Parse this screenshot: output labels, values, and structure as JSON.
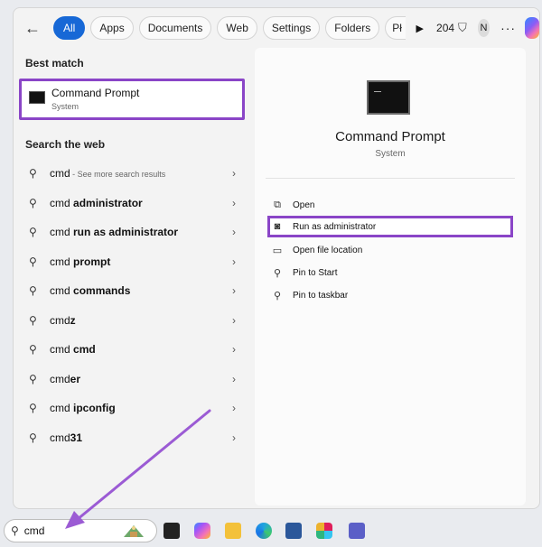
{
  "topbar": {
    "tabs": [
      "All",
      "Apps",
      "Documents",
      "Web",
      "Settings",
      "Folders",
      "Pł"
    ],
    "count": "204",
    "avatar_initial": "N"
  },
  "left": {
    "best_match_label": "Best match",
    "best_match": {
      "title": "Command Prompt",
      "subtitle": "System"
    },
    "search_web_label": "Search the web",
    "web_results": [
      {
        "prefix": "cmd",
        "suffix": "",
        "hint": " - See more search results"
      },
      {
        "prefix": "cmd ",
        "suffix": "administrator",
        "hint": ""
      },
      {
        "prefix": "cmd ",
        "suffix": "run as administrator",
        "hint": ""
      },
      {
        "prefix": "cmd ",
        "suffix": "prompt",
        "hint": ""
      },
      {
        "prefix": "cmd ",
        "suffix": "commands",
        "hint": ""
      },
      {
        "prefix": "cmd",
        "suffix": "z",
        "hint": ""
      },
      {
        "prefix": "cmd ",
        "suffix": "cmd",
        "hint": ""
      },
      {
        "prefix": "cmd",
        "suffix": "er",
        "hint": ""
      },
      {
        "prefix": "cmd ",
        "suffix": "ipconfig",
        "hint": ""
      },
      {
        "prefix": "cmd",
        "suffix": "31",
        "hint": ""
      }
    ]
  },
  "right": {
    "title": "Command Prompt",
    "subtitle": "System",
    "actions": [
      {
        "label": "Open",
        "icon": "open-icon"
      },
      {
        "label": "Run as administrator",
        "icon": "shield-icon"
      },
      {
        "label": "Open file location",
        "icon": "folder-icon"
      },
      {
        "label": "Pin to Start",
        "icon": "pin-icon"
      },
      {
        "label": "Pin to taskbar",
        "icon": "pin-icon"
      }
    ]
  },
  "taskbar": {
    "search_value": "cmd"
  },
  "colors": {
    "accent": "#1768d6",
    "highlight": "#8a45c7",
    "arrow": "#9b5bd4"
  }
}
